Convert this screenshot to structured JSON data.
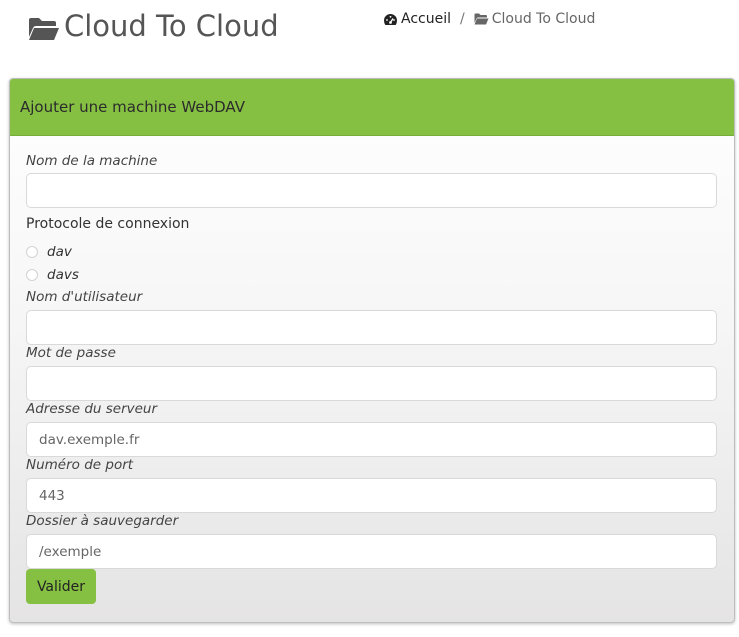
{
  "header": {
    "title": "Cloud To Cloud",
    "title_icon": "folder-open-icon"
  },
  "breadcrumb": {
    "home_label": "Accueil",
    "home_icon": "dashboard-icon",
    "separator": "/",
    "current_label": "Cloud To Cloud",
    "current_icon": "folder-open-icon"
  },
  "panel": {
    "heading": "Ajouter une machine WebDAV",
    "colors": {
      "heading_bg": "#86c043",
      "button_bg": "#86c043"
    }
  },
  "form": {
    "machine_name": {
      "label": "Nom de la machine",
      "value": "",
      "placeholder": ""
    },
    "protocol": {
      "label": "Protocole de connexion",
      "options": [
        "dav",
        "davs"
      ],
      "selected": null
    },
    "username": {
      "label": "Nom d'utilisateur",
      "value": "",
      "placeholder": ""
    },
    "password": {
      "label": "Mot de passe",
      "value": "",
      "placeholder": ""
    },
    "server": {
      "label": "Adresse du serveur",
      "value": "",
      "placeholder": "dav.exemple.fr"
    },
    "port": {
      "label": "Numéro de port",
      "value": "",
      "placeholder": "443"
    },
    "folder": {
      "label": "Dossier à sauvegarder",
      "value": "",
      "placeholder": "/exemple"
    },
    "submit_label": "Valider"
  }
}
